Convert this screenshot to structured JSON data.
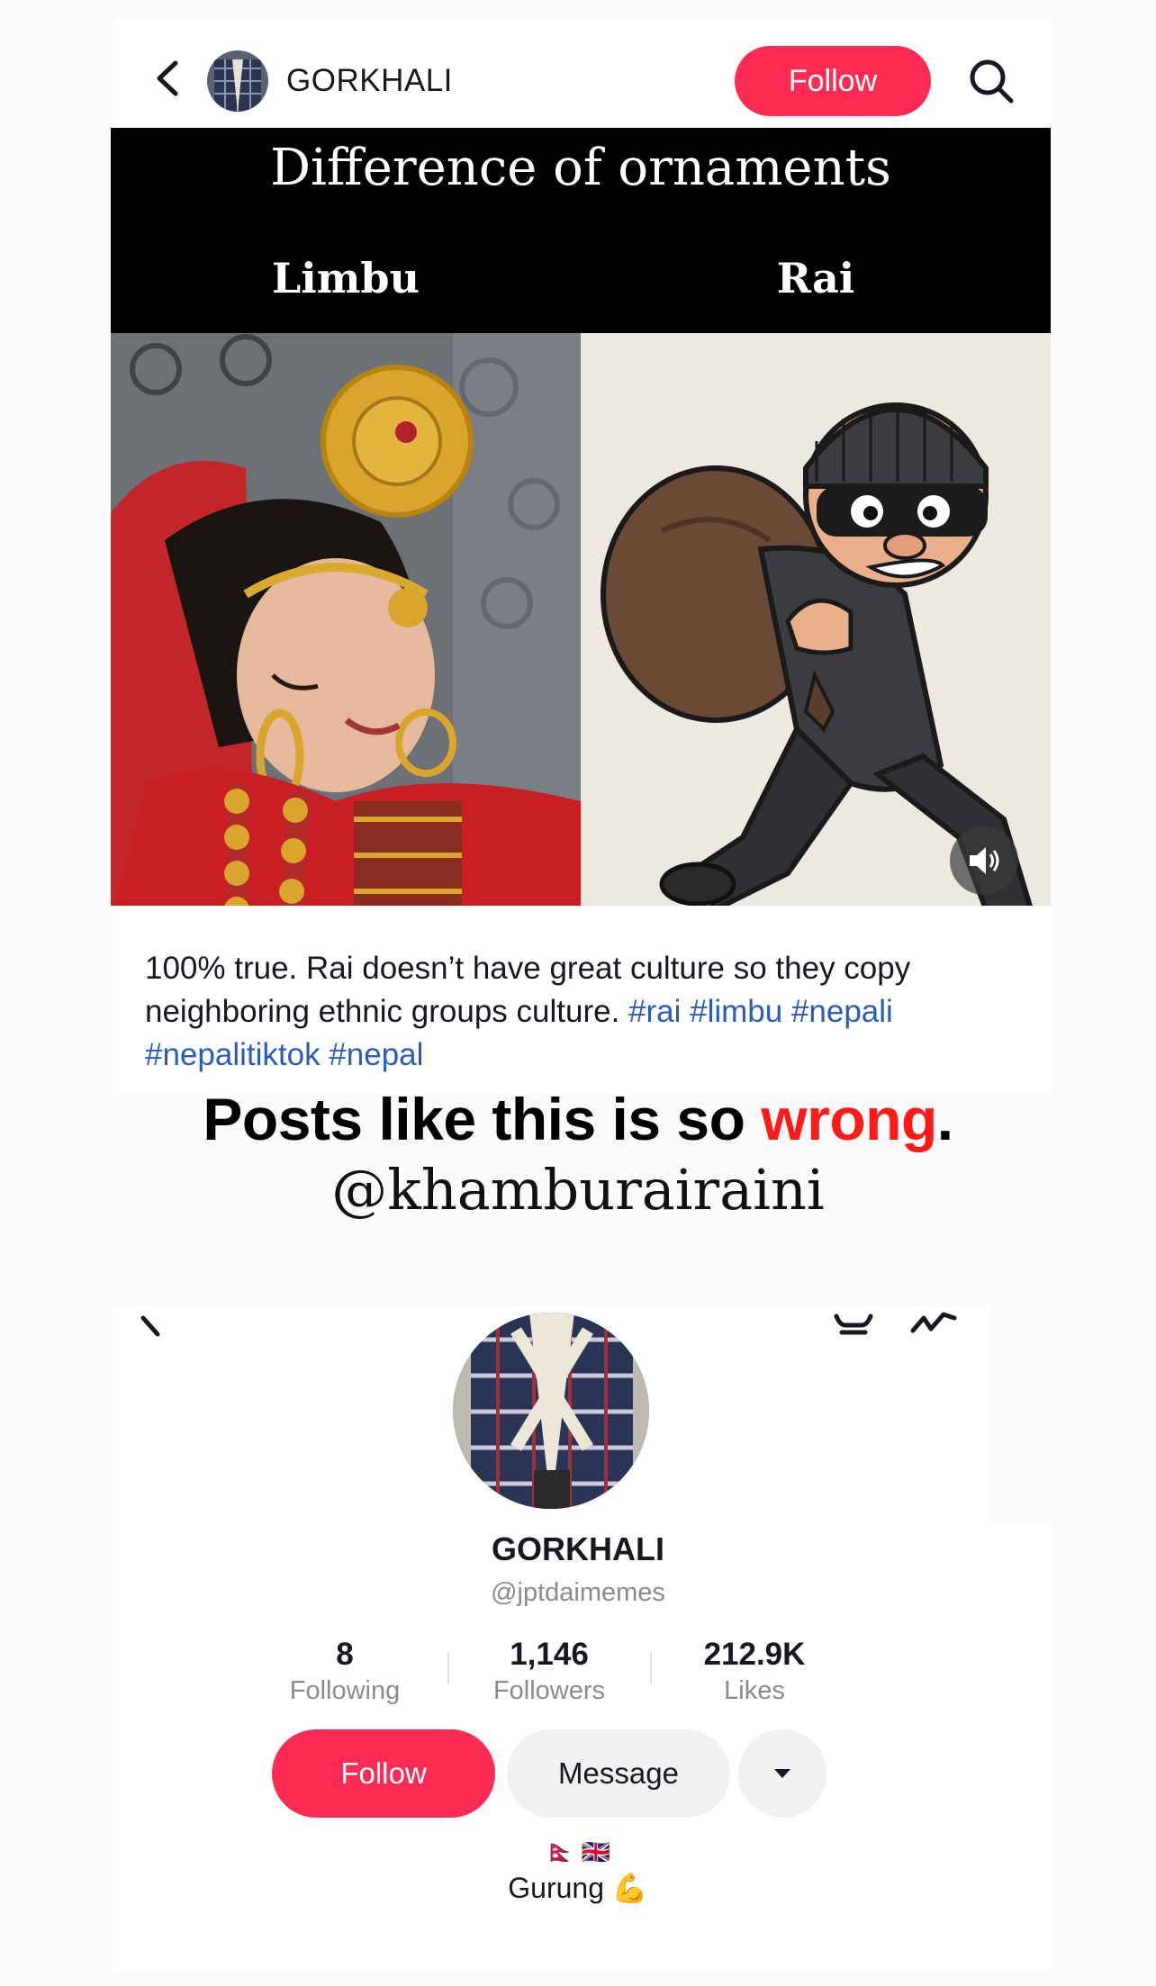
{
  "post_header": {
    "account_name": "GORKHALI",
    "follow_label": "Follow"
  },
  "post_image": {
    "title": "Difference of ornaments",
    "left_label": "Limbu",
    "right_label": "Rai"
  },
  "caption": {
    "text": "100% true. Rai doesn’t have great culture so they copy neighboring ethnic groups culture. ",
    "hashtags": "#rai #limbu #nepali #nepalitiktok #nepal"
  },
  "overlay": {
    "headline_start": "Posts like this is so ",
    "headline_red": "wrong",
    "headline_end": ".",
    "handle": "@khamburairaini"
  },
  "profile": {
    "name": "GORKHALI",
    "username": "@jptdaimemes",
    "stats": [
      {
        "value": "8",
        "label": "Following"
      },
      {
        "value": "1,146",
        "label": "Followers"
      },
      {
        "value": "212.9K",
        "label": "Likes"
      }
    ],
    "follow_label": "Follow",
    "message_label": "Message",
    "flags": "🇳🇵 🇬🇧",
    "bio": "Gurung 💪"
  },
  "colors": {
    "accent": "#fe2c55",
    "hashtag": "#2b5db8",
    "highlight_red": "#ff1a1a"
  },
  "icons": [
    "back-arrow-icon",
    "search-icon",
    "speaker-icon",
    "share-icon",
    "more-icon",
    "caret-down-icon"
  ]
}
